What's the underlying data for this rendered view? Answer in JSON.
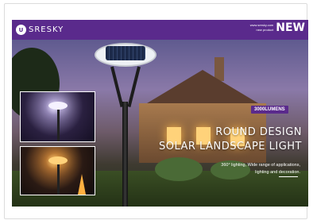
{
  "brand": {
    "logo_mark": "U",
    "name": "SRESKY"
  },
  "header": {
    "line1": "www.sresky.com",
    "line2": "new product",
    "new_label": "NEW"
  },
  "promo": {
    "lumens_badge": "3000LUMENS",
    "headline_line1": "ROUND DESIGN",
    "headline_line2": "SOLAR LANDSCAPE LIGHT",
    "desc_line1": "360° lighting, Wide range of applications,",
    "desc_line2": "lighting and decoration."
  },
  "colors": {
    "brand_purple": "#5a2a8c",
    "text": "#ffffff"
  }
}
